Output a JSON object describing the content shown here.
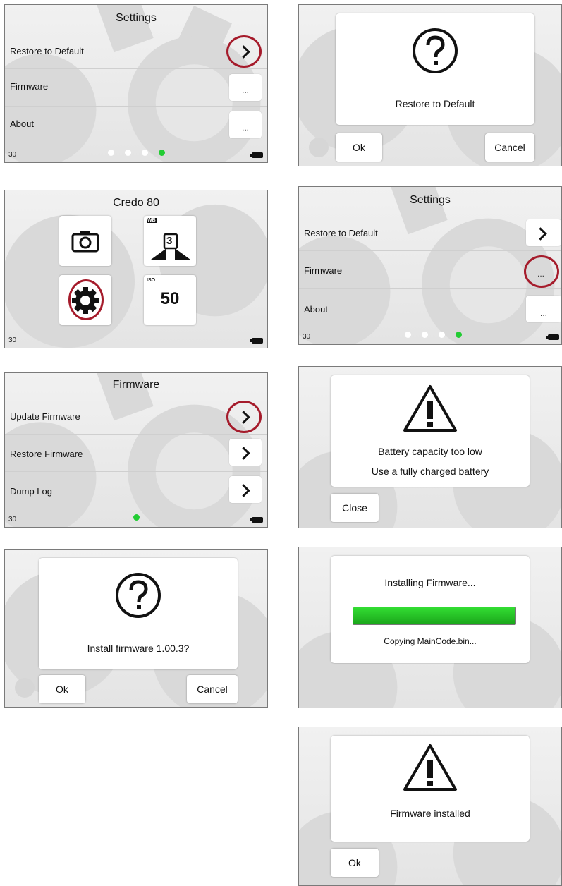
{
  "colors": {
    "highlight": "#a51b2b",
    "active_dot": "#22cc33",
    "progress": "#22bb22"
  },
  "screen1": {
    "title": "Settings",
    "rows": [
      {
        "label": "Restore to Default",
        "action_icon": "chevron-right-icon"
      },
      {
        "label": "Firmware",
        "button_label": "..."
      },
      {
        "label": "About",
        "button_label": "..."
      }
    ],
    "status_number": "30",
    "page_count": 4,
    "active_page": 4
  },
  "screen2": {
    "icon": "question-icon",
    "message": "Restore to Default",
    "ok_label": "Ok",
    "cancel_label": "Cancel"
  },
  "screen3": {
    "title": "Credo 80",
    "tiles": [
      {
        "name": "camera",
        "icon": "camera-icon"
      },
      {
        "name": "white-balance",
        "badge": "WB",
        "value": "3",
        "icon": "white-balance-icon"
      },
      {
        "name": "settings",
        "icon": "gear-icon"
      },
      {
        "name": "iso",
        "badge": "ISO",
        "value": "50"
      }
    ],
    "status_number": "30"
  },
  "screen4": {
    "title": "Settings",
    "rows": [
      {
        "label": "Restore to Default",
        "action_icon": "chevron-right-icon"
      },
      {
        "label": "Firmware",
        "button_label": "..."
      },
      {
        "label": "About",
        "button_label": "..."
      }
    ],
    "status_number": "30",
    "page_count": 4,
    "active_page": 4
  },
  "screen5": {
    "title": "Firmware",
    "rows": [
      {
        "label": "Update Firmware",
        "action_icon": "chevron-right-icon"
      },
      {
        "label": "Restore Firmware",
        "action_icon": "chevron-right-icon"
      },
      {
        "label": "Dump Log",
        "action_icon": "chevron-right-icon"
      }
    ],
    "status_number": "30",
    "page_count": 1,
    "active_page": 1
  },
  "screen6": {
    "icon": "warning-icon",
    "line1": "Battery capacity too low",
    "line2": "Use a fully charged battery",
    "close_label": "Close"
  },
  "screen7": {
    "icon": "question-icon",
    "message": "Install firmware 1.00.3?",
    "ok_label": "Ok",
    "cancel_label": "Cancel"
  },
  "screen8": {
    "title": "Installing Firmware...",
    "progress": 1.0,
    "status": "Copying MainCode.bin..."
  },
  "screen9": {
    "icon": "warning-icon",
    "message": "Firmware installed",
    "ok_label": "Ok"
  }
}
